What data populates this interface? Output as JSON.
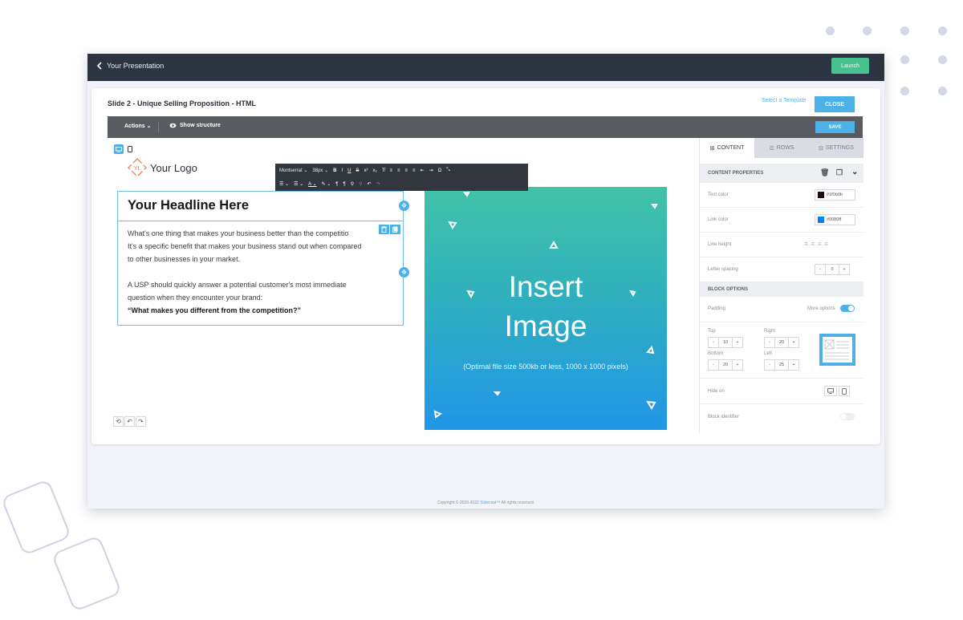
{
  "topbar": {
    "back_label": "Your Presentation",
    "launch_label": "Launch"
  },
  "slide": {
    "title": "Slide 2 - Unique Selling Proposition - HTML",
    "select_template": "Select a Template",
    "close_label": "CLOSE"
  },
  "editor_toolbar": {
    "actions_label": "Actions",
    "show_structure_label": "Show structure",
    "save_label": "SAVE"
  },
  "canvas": {
    "logo_text": "Your Logo",
    "logo_mark": "YL",
    "headline": "Your Headline Here",
    "body_p1": "What's one thing that makes your business better than the competitio",
    "body_p1b": "It's a specific benefit that makes your business stand out when compared",
    "body_p1c": "to other businesses in your market.",
    "body_p2": "A USP should quickly answer a potential customer's most immediate",
    "body_p2b": "question when they encounter your brand:",
    "body_p2c": "“What makes you different from the competition?”",
    "image_line1": "Insert",
    "image_line2": "Image",
    "image_hint": "(Optimal file size 500kb or less, 1000 x 1000 pixels)"
  },
  "format_toolbar": {
    "font": "Montserrat",
    "size": "38px"
  },
  "panel": {
    "tabs": [
      "CONTENT",
      "ROWS",
      "SETTINGS"
    ],
    "content_properties": "CONTENT PROPERTIES",
    "text_color_label": "Text color",
    "text_color_value": "#1f0b0b",
    "link_color_label": "Link color",
    "link_color_value": "#0080ff",
    "line_height_label": "Line height",
    "letter_spacing_label": "Letter spacing",
    "letter_spacing_value": "0",
    "block_options": "BLOCK OPTIONS",
    "padding_label": "Padding",
    "more_options_label": "More options",
    "top_label": "Top",
    "top_value": "10",
    "right_label": "Right",
    "right_value": "20",
    "bottom_label": "Bottom",
    "bottom_value": "20",
    "left_label": "Left",
    "left_value": "25",
    "hide_on_label": "Hide on",
    "block_identifier_label": "Block identifier"
  },
  "footer": {
    "prefix": "Copyright © 2020-2022 ",
    "brand": "Slidecast™",
    "suffix": " All rights reserved."
  },
  "colors": {
    "accent": "#4db1e7",
    "launch": "#49c08f",
    "topbar": "#2c3442"
  }
}
